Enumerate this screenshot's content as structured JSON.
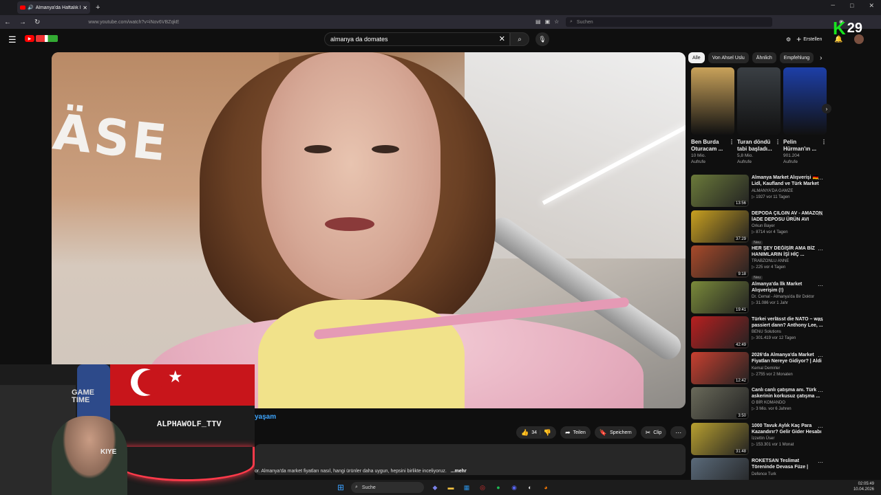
{
  "browser": {
    "tab_title": "Almanya'da Haftalık Market",
    "url": "www.youtube.com/watch?v=iNov6VBZqkE",
    "web_search_placeholder": "Suchen"
  },
  "header": {
    "search_value": "almanya da domates",
    "create_label": "Erstellen"
  },
  "overlay": {
    "k_letter": "K",
    "counter": "29"
  },
  "video": {
    "wall_text": "ÄSE",
    "title_fragment": "yaşam",
    "likes": "34",
    "share_label": "Teilen",
    "save_label": "Speichern",
    "clip_label": "Clip",
    "description": "or. Almanya'da market fiyatları nasıl, hangi ürünler daha uygun, hepsini birlikte inceliyoruz.",
    "more_label": "...mehr"
  },
  "webcam": {
    "game_text_1": "GAME",
    "game_text_2": "TIME",
    "sign_text": "ALPHAWOLF_TTV",
    "shirt_text": "KIYE"
  },
  "sidebar": {
    "chips": [
      "Alle",
      "Von Ahsel Uslu",
      "Ähnlich",
      "Empfehlung"
    ],
    "shorts": [
      {
        "title": "Ben Burda Oturacam ...",
        "views": "10 Mio.",
        "unit": "Aufrufe",
        "color": "#c9a25a"
      },
      {
        "title": "Turan döndü tabi başladı...",
        "views": "5,8 Mio.",
        "unit": "Aufrufe",
        "color": "#3a3f44"
      },
      {
        "title": "Pelin Hürman'ın ...",
        "views": "901.204",
        "unit": "Aufrufe",
        "color": "#1d3fa8"
      }
    ],
    "videos": [
      {
        "title": "Almanya Market Alışverişi 🇩🇪 Lidl, Kaufland ve Türk Market ...",
        "channel": "ALMANYA'DA GAMZE",
        "meta": "▷ 1927  vor 11 Tagen",
        "dur": "13:56",
        "badge": "",
        "color": "#6b7a3a"
      },
      {
        "title": "DEPODA ÇILGIN AV - AMAZON İADE DEPOSU ÜRÜN AVI",
        "channel": "Orkun Bayer",
        "meta": "▷ 8714  vor 4 Tagen",
        "dur": "37:29",
        "badge": "Neu",
        "color": "#c9a020"
      },
      {
        "title": "HER ŞEY DEĞİŞİR AMA BİZ HANIMLARIN İŞİ HİÇ ...",
        "channel": "TRABZONLU ANNE",
        "meta": "▷ 225  vor 4 Tagen",
        "dur": "9:18",
        "badge": "Neu",
        "color": "#a84a2a"
      },
      {
        "title": "Almanya'da İlk Market Alışverişim (!)",
        "channel": "Dr. Cemal - Almanya'da Bir Doktor",
        "meta": "▷ 31.086  vor 1 Jahr",
        "dur": "19:41",
        "badge": "",
        "color": "#7a8a3a"
      },
      {
        "title": "Türkei verlässt die NATO – was passiert dann?  Anthony Lee, ...",
        "channel": "BENU Solutions",
        "meta": "▷ 301.419  vor 12 Tagen",
        "dur": "42:49",
        "badge": "",
        "color": "#b82020"
      },
      {
        "title": "2026'da Almanya'da Market Fiyatları Nereye Gidiyor? | Aldi ...",
        "channel": "Kemal Demirler",
        "meta": "▷ 2755  vor 2 Monaten",
        "dur": "12:42",
        "badge": "",
        "color": "#c84030"
      },
      {
        "title": "Canlı canlı çatışma anı. Türk askerinin korkusuz çatışma ...",
        "channel": "O BİR KOMANDO",
        "meta": "▷ 3 Mio.  vor 6 Jahren",
        "dur": "3:50",
        "badge": "",
        "color": "#6a6a5a"
      },
      {
        "title": "1000 Tavuk Aylık Kaç Para Kazandırır? Gelir Gider Hesabı",
        "channel": "İzzettin Üser",
        "meta": "▷ 153.301  vor 1 Monat",
        "dur": "31:48",
        "badge": "",
        "color": "#b8a030"
      },
      {
        "title": "ROKETSAN Teslimat Töreninde Devasa Füze | \"Koca Oğlan\" ...",
        "channel": "Defence Turk",
        "meta": "",
        "dur": "",
        "badge": "",
        "color": "#5a6a7a"
      }
    ]
  },
  "taskbar": {
    "search_label": "Suche",
    "time": "02:05:49",
    "date": "10.04.2026"
  }
}
